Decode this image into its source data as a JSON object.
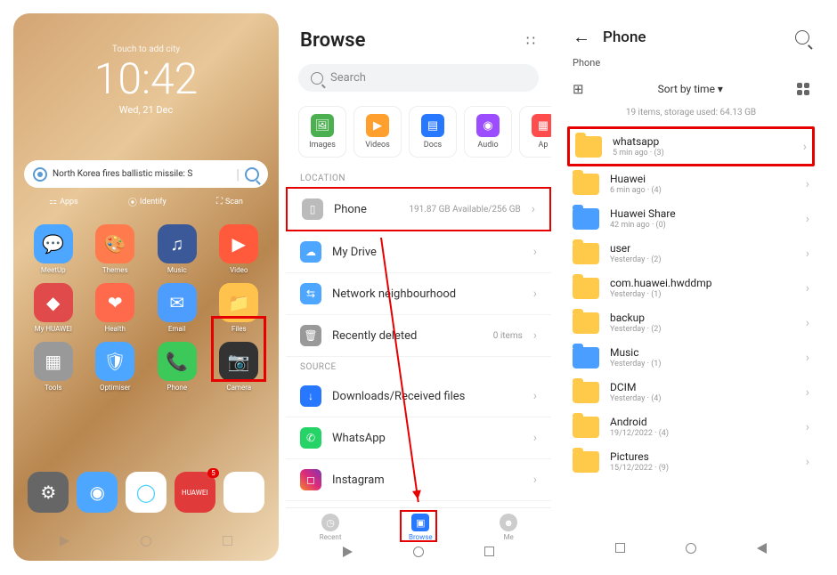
{
  "home": {
    "touch_city": "Touch to add city",
    "time": "10:42",
    "date": "Wed, 21 Dec",
    "headline": "North Korea fires ballistic missile: S",
    "quick": {
      "apps": "Apps",
      "identify": "Identify",
      "scan": "Scan"
    },
    "apps": [
      {
        "label": "MeetUp",
        "color": "#4da6ff"
      },
      {
        "label": "Themes",
        "color": "#ff7a4d"
      },
      {
        "label": "Music",
        "color": "#3b5998"
      },
      {
        "label": "Video",
        "color": "#ff5a3c"
      },
      {
        "label": "My HUAWEI",
        "color": "#e04a4a"
      },
      {
        "label": "Health",
        "color": "#ff6a4d"
      },
      {
        "label": "Email",
        "color": "#4d9dff"
      },
      {
        "label": "Files",
        "color": "#ffc34d"
      },
      {
        "label": "Tools",
        "color": "#999"
      },
      {
        "label": "Optimiser",
        "color": "#4da6ff"
      },
      {
        "label": "Phone",
        "color": "#3cc95a"
      },
      {
        "label": "Camera",
        "color": "#333"
      }
    ],
    "dock": {
      "badge": "5",
      "colors": {
        "settings": "#666",
        "browser": "#4da6ff",
        "search": "#4dcfff",
        "appgallery": "#e03a3a",
        "gallery": "#fff"
      }
    }
  },
  "browse": {
    "title": "Browse",
    "search_placeholder": "Search",
    "categories": [
      {
        "label": "Images",
        "color": "#4caf50"
      },
      {
        "label": "Videos",
        "color": "#ff9f2e"
      },
      {
        "label": "Docs",
        "color": "#2878ff"
      },
      {
        "label": "Audio",
        "color": "#9c4dff"
      },
      {
        "label": "Ap",
        "color": "#ff4d4d"
      }
    ],
    "sections": {
      "location": "LOCATION",
      "source": "SOURCE"
    },
    "phone": {
      "label": "Phone",
      "detail": "191.87 GB Available/256 GB"
    },
    "mydrive": "My Drive",
    "network": "Network neighbourhood",
    "recent_del": {
      "label": "Recently deleted",
      "detail": "0 items"
    },
    "src": {
      "downloads": "Downloads/Received files",
      "whatsapp": "WhatsApp",
      "instagram": "Instagram"
    },
    "nav": {
      "recent": "Recent",
      "browse": "Browse",
      "me": "Me"
    }
  },
  "phone_screen": {
    "title": "Phone",
    "crumb": "Phone",
    "sort": "Sort by time",
    "stats": "19 items, storage used: 64.13 GB",
    "folders": [
      {
        "name": "whatsapp",
        "meta": "5 min ago · (3)",
        "hl": true
      },
      {
        "name": "Huawei",
        "meta": "6 min ago · (4)"
      },
      {
        "name": "Huawei Share",
        "meta": "42 min ago · (0)",
        "blue": true
      },
      {
        "name": "user",
        "meta": "Yesterday · (2)"
      },
      {
        "name": "com.huawei.hwddmp",
        "meta": "Yesterday · (1)"
      },
      {
        "name": "backup",
        "meta": "Yesterday · (2)"
      },
      {
        "name": "Music",
        "meta": "Yesterday · (1)",
        "blue": true
      },
      {
        "name": "DCIM",
        "meta": "Yesterday · (4)"
      },
      {
        "name": "Android",
        "meta": "19/12/2022 · (4)"
      },
      {
        "name": "Pictures",
        "meta": "15/12/2022 · (9)"
      }
    ]
  }
}
